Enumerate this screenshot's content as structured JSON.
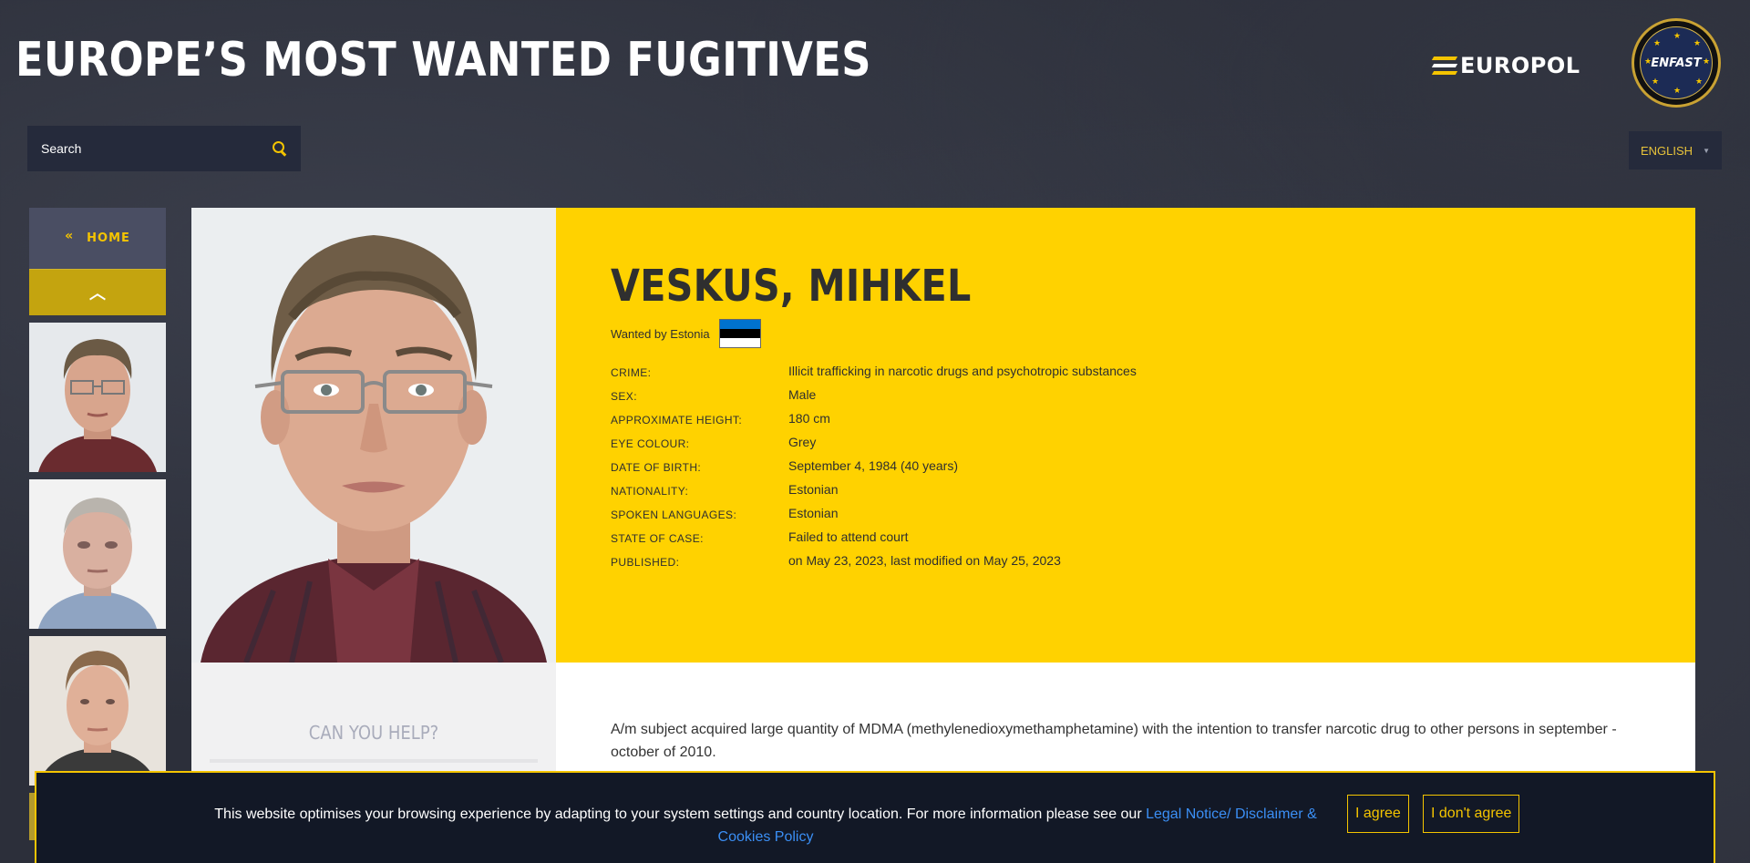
{
  "site": {
    "title": "EUROPE’S MOST WANTED FUGITIVES",
    "europol_logo": "EUROPOL",
    "enfast_logo": "ENFAST"
  },
  "search": {
    "placeholder": "Search"
  },
  "language": {
    "selected": "ENGLISH"
  },
  "side_nav": {
    "home_label": "HOME",
    "home_icon": "double-chevron-left-icon",
    "up_icon": "chevron-up-icon"
  },
  "fugitive": {
    "name": "VESKUS, MIHKEL",
    "wanted_by": "Wanted by Estonia",
    "flag_colors": [
      "#0072ce",
      "#000000",
      "#ffffff"
    ],
    "details": [
      {
        "label": "Crime:",
        "value": "Illicit trafficking in narcotic drugs and psychotropic substances"
      },
      {
        "label": "Sex:",
        "value": "Male"
      },
      {
        "label": "Approximate height:",
        "value": "180 cm"
      },
      {
        "label": "Eye colour:",
        "value": "Grey"
      },
      {
        "label": "Date of birth:",
        "value": "September 4, 1984 (40 years)"
      },
      {
        "label": "Nationality:",
        "value": "Estonian"
      },
      {
        "label": "Spoken languages:",
        "value": "Estonian"
      },
      {
        "label": "State of case:",
        "value": "Failed to attend court"
      },
      {
        "label": "Published:",
        "value": "on May 23, 2023, last modified on May 25, 2023"
      }
    ],
    "description": "A/m subject acquired large quantity of MDMA (methylenedioxymethamphetamine) with the intention to transfer narcotic drug to other persons in september - october of 2010."
  },
  "help": {
    "title": "CAN YOU HELP?"
  },
  "cookie": {
    "text": "This website optimises your browsing experience by adapting to your system settings and country location. For more information please see our ",
    "link": "Legal Notice/ Disclaimer & Cookies Policy",
    "agree": "I agree",
    "disagree": "I don't agree"
  },
  "colors": {
    "accent_yellow": "#ffd200",
    "background": "#2c2f3a",
    "link_blue": "#3b8ff5"
  }
}
